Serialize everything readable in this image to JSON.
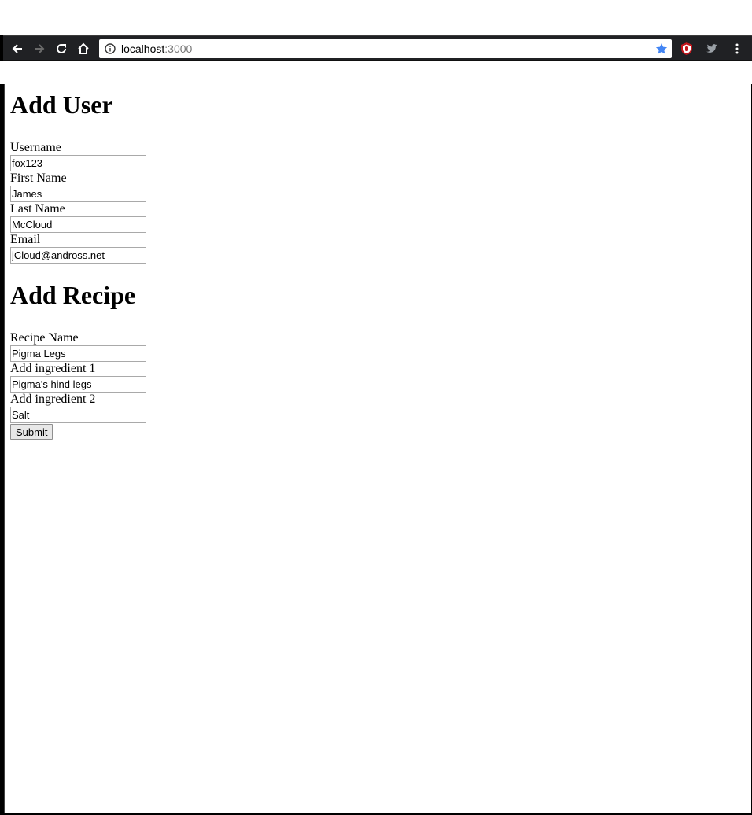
{
  "browser": {
    "url_host": "localhost",
    "url_port": ":3000",
    "icons": [
      "back-icon",
      "forward-icon",
      "reload-icon",
      "home-icon",
      "info-icon",
      "bookmark-star-icon",
      "ublock-icon",
      "twitter-icon",
      "menu-icon"
    ],
    "accent_color": "#4285f4"
  },
  "user_form": {
    "title": "Add User",
    "username_label": "Username",
    "username_value": "fox123",
    "first_name_label": "First Name",
    "first_name_value": "James",
    "last_name_label": "Last Name",
    "last_name_value": "McCloud",
    "email_label": "Email",
    "email_value": "jCloud@andross.net"
  },
  "recipe_form": {
    "title": "Add Recipe",
    "recipe_name_label": "Recipe Name",
    "recipe_name_value": "Pigma Legs",
    "ingredient1_label": "Add ingredient 1",
    "ingredient1_value": "Pigma's hind legs",
    "ingredient2_label": "Add ingredient 2",
    "ingredient2_value": "Salt",
    "submit_label": "Submit"
  }
}
